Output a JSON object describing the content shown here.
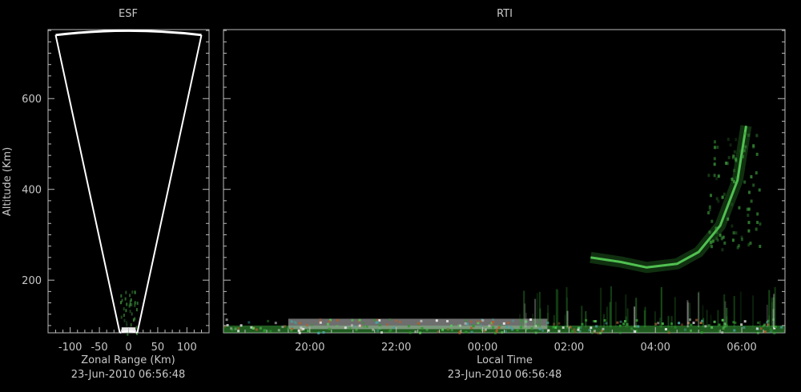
{
  "chart_data": [
    {
      "type": "fan-radar",
      "title": "ESF",
      "xlabel": "Zonal Range (Km)",
      "ylabel": "Altitude (Km)",
      "timestamp": "23-Jun-2010 06:56:48",
      "xlim": [
        -138,
        138
      ],
      "ylim": [
        84,
        752
      ],
      "x_ticks": [
        "-100",
        "-50",
        "0",
        "50",
        "100"
      ],
      "x_tick_values": [
        -100,
        -50,
        0,
        50,
        100
      ],
      "y_ticks": [
        "200",
        "400",
        "600"
      ],
      "y_tick_values": [
        200,
        400,
        600
      ],
      "fan": {
        "apex_altitude": 84,
        "edge_altitude": 740,
        "left_edge_range": -125,
        "right_edge_range": 125
      },
      "echo": {
        "range_min": -15,
        "range_max": 15,
        "alt_min": 84,
        "alt_max": 180,
        "color": "#3a8a3a"
      }
    },
    {
      "type": "heatmap",
      "title": "RTI",
      "xlabel": "Local Time",
      "timestamp": "23-Jun-2010 06:56:48",
      "xlim_hours": [
        18.0,
        31.0
      ],
      "ylim": [
        84,
        752
      ],
      "x_ticks": [
        "20:00",
        "22:00",
        "00:00",
        "02:00",
        "04:00",
        "06:00"
      ],
      "x_tick_hours": [
        20,
        22,
        24,
        26,
        28,
        30
      ],
      "y_tick_values": [
        200,
        400,
        600
      ],
      "echo_colors": [
        "#2f9a2f",
        "#58c858",
        "#b06030",
        "#e8e8e8",
        "#4aa0a0"
      ],
      "layers": [
        {
          "name": "bottom",
          "t_start": 18.0,
          "t_end": 31.0,
          "alt_min": 84,
          "alt_max": 100,
          "color": "#3aa83a"
        },
        {
          "name": "bright-band",
          "t_start": 19.5,
          "t_end": 25.5,
          "alt_min": 92,
          "alt_max": 115,
          "color": "#c8c8c8"
        }
      ],
      "plume": [
        {
          "t": 26.5,
          "alt": 250
        },
        {
          "t": 27.2,
          "alt": 240
        },
        {
          "t": 27.8,
          "alt": 228
        },
        {
          "t": 28.5,
          "alt": 236
        },
        {
          "t": 29.0,
          "alt": 262
        },
        {
          "t": 29.5,
          "alt": 320
        },
        {
          "t": 29.9,
          "alt": 420
        },
        {
          "t": 30.1,
          "alt": 540
        }
      ]
    }
  ]
}
